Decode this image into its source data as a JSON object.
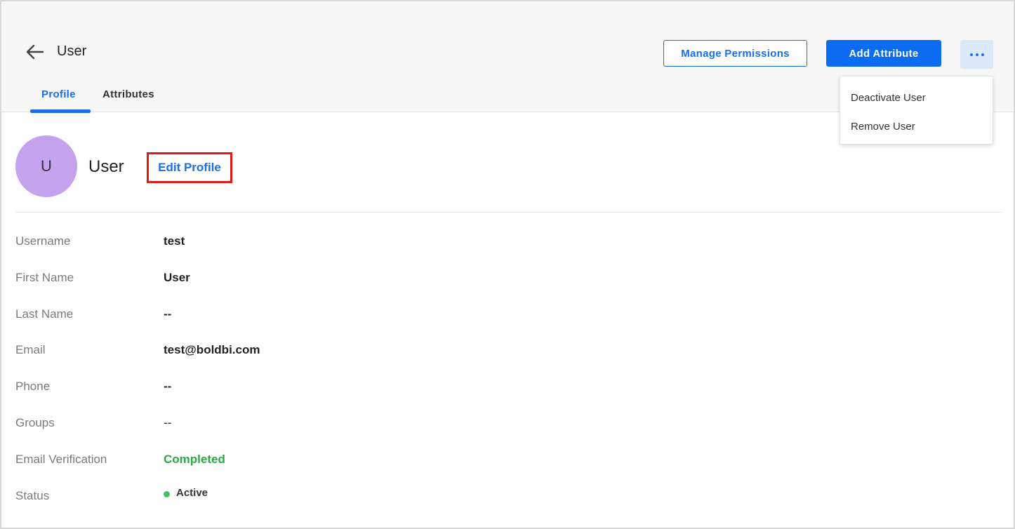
{
  "header": {
    "title": "User",
    "tabs": [
      {
        "label": "Profile",
        "active": true
      },
      {
        "label": "Attributes",
        "active": false
      }
    ],
    "manage_permissions_label": "Manage Permissions",
    "add_attribute_label": "Add Attribute",
    "more_icon": "ellipsis-icon",
    "back_icon": "arrow-left-icon"
  },
  "dropdown_menu": {
    "items": [
      {
        "label": "Deactivate User"
      },
      {
        "label": "Remove User"
      }
    ]
  },
  "profile": {
    "avatar_initial": "U",
    "name": "User",
    "edit_label": "Edit Profile",
    "fields": [
      {
        "label": "Username",
        "value": "test"
      },
      {
        "label": "First Name",
        "value": "User"
      },
      {
        "label": "Last Name",
        "value": "--"
      },
      {
        "label": "Email",
        "value": "test@boldbi.com"
      },
      {
        "label": "Phone",
        "value": "--"
      },
      {
        "label": "Groups",
        "value": "--"
      },
      {
        "label": "Email Verification",
        "value": "Completed"
      },
      {
        "label": "Status",
        "value": "Active"
      }
    ]
  },
  "colors": {
    "accent": "#1a6fe8",
    "primary_button": "#0b6cf2",
    "avatar": "#c5a2ee",
    "success": "#2aa844",
    "highlight_border": "#e01919"
  }
}
